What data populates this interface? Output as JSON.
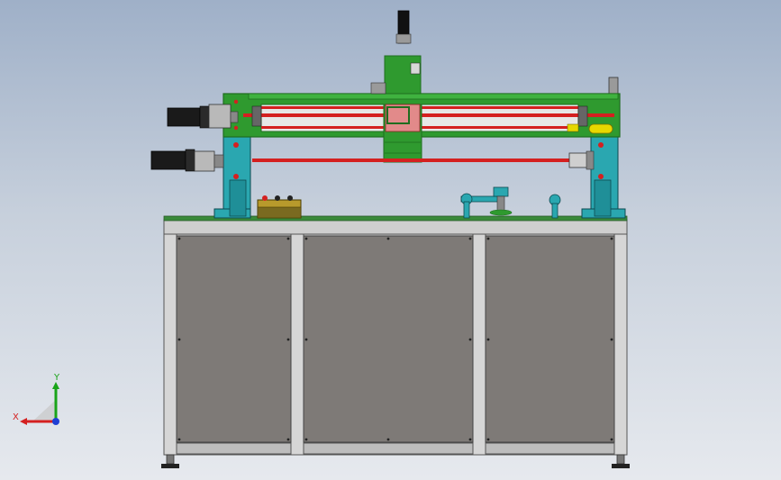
{
  "viewport": {
    "background_top": "#9fb0c8",
    "background_bottom": "#e6e9ee"
  },
  "colors": {
    "frame_green": "#2f9a2f",
    "frame_green_dark": "#1f6d1f",
    "rod_red": "#d42020",
    "bracket_cyan": "#2aa7b0",
    "motor_black": "#1a1a1a",
    "table_gray": "#c9c9c9",
    "panel_gray": "#7e7a77",
    "control_box_yellow": "#b89a2c",
    "highlight_yellow": "#e6d800"
  },
  "icons": {
    "triad": "coordinate-axes-triad-icon"
  },
  "triad": {
    "x_label": "X",
    "y_label": "Y",
    "x_color": "#d42020",
    "y_color": "#19a419",
    "z_color": "#1f3fd4"
  }
}
